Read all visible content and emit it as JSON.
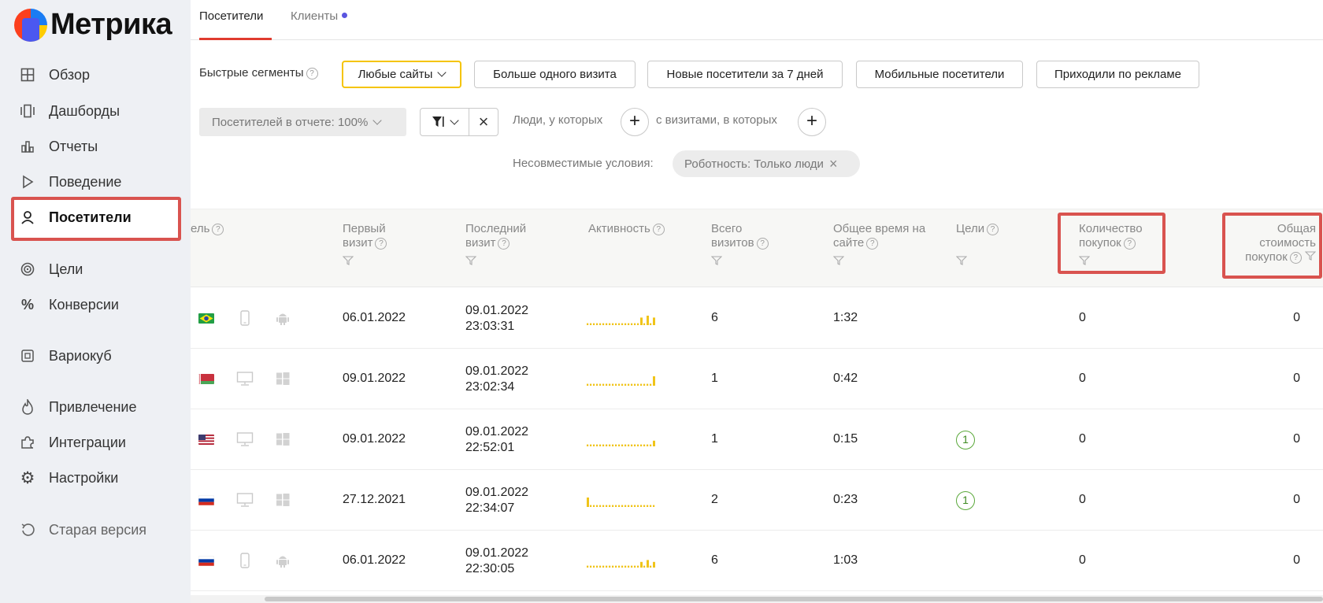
{
  "app": {
    "logo_text": "Метрика"
  },
  "sidebar": {
    "items": [
      {
        "label": "Обзор",
        "icon": "grid-icon"
      },
      {
        "label": "Дашборды",
        "icon": "dashboards-icon"
      },
      {
        "label": "Отчеты",
        "icon": "bar-chart-icon"
      },
      {
        "label": "Поведение",
        "icon": "play-icon"
      },
      {
        "label": "Посетители",
        "icon": "user-icon",
        "active": true
      },
      {
        "label": "Цели",
        "icon": "target-icon"
      },
      {
        "label": "Конверсии",
        "icon": "percent-icon"
      },
      {
        "label": "Вариокуб",
        "icon": "variocube-icon"
      },
      {
        "label": "Привлечение",
        "icon": "flame-icon"
      },
      {
        "label": "Интеграции",
        "icon": "puzzle-icon"
      },
      {
        "label": "Настройки",
        "icon": "gear-icon"
      },
      {
        "label": "Старая версия",
        "icon": "undo-icon"
      }
    ]
  },
  "tabs": [
    {
      "label": "Посетители",
      "active": true
    },
    {
      "label": "Клиенты",
      "active": false
    }
  ],
  "segments": {
    "label": "Быстрые сегменты",
    "selected": "Любые сайты",
    "buttons": [
      "Больше одного визита",
      "Новые посетители за 7 дней",
      "Мобильные посетители",
      "Приходили по рекламе"
    ]
  },
  "filters": {
    "report_share": "Посетителей в отчете: 100%",
    "people_label": "Люди, у которых",
    "visits_label": "с визитами, в которых",
    "incompatible_label": "Несовместимые условия:",
    "incompatible_chip": "Роботность: Только люди"
  },
  "table": {
    "columns": {
      "partial": "ель",
      "first_visit": [
        "Первый",
        "визит"
      ],
      "last_visit": [
        "Последний",
        "визит"
      ],
      "activity": "Активность",
      "total_visits": [
        "Всего",
        "визитов"
      ],
      "total_time": [
        "Общее время на",
        "сайте"
      ],
      "goals": "Цели",
      "purchases": [
        "Количество",
        "покупок"
      ],
      "purchase_value": [
        "Общая",
        "стоимость",
        "покупок"
      ]
    },
    "rows": [
      {
        "flag": "brazil",
        "device": "phone-icon",
        "os": "android-icon",
        "first_visit": "06.01.2022",
        "last_date": "09.01.2022",
        "last_time": "23:03:31",
        "visits": "6",
        "time": "1:32",
        "goals": "",
        "purchases": "0",
        "value": "0",
        "activity": [
          1,
          1,
          1,
          1,
          1,
          1,
          1,
          1,
          1,
          1,
          1,
          1,
          1,
          1,
          1,
          1,
          1,
          4,
          1,
          5,
          1,
          4
        ]
      },
      {
        "flag": "belarus",
        "device": "monitor-icon",
        "os": "windows-icon",
        "first_visit": "09.01.2022",
        "last_date": "09.01.2022",
        "last_time": "23:02:34",
        "visits": "1",
        "time": "0:42",
        "goals": "",
        "purchases": "0",
        "value": "0",
        "activity": [
          1,
          1,
          1,
          1,
          1,
          1,
          1,
          1,
          1,
          1,
          1,
          1,
          1,
          1,
          1,
          1,
          1,
          1,
          1,
          1,
          1,
          5
        ]
      },
      {
        "flag": "usa",
        "device": "monitor-icon",
        "os": "windows-icon",
        "first_visit": "09.01.2022",
        "last_date": "09.01.2022",
        "last_time": "22:52:01",
        "visits": "1",
        "time": "0:15",
        "goals": "1",
        "purchases": "0",
        "value": "0",
        "activity": [
          1,
          1,
          1,
          1,
          1,
          1,
          1,
          1,
          1,
          1,
          1,
          1,
          1,
          1,
          1,
          1,
          1,
          1,
          1,
          1,
          1,
          3
        ]
      },
      {
        "flag": "russia",
        "device": "monitor-icon",
        "os": "windows-icon",
        "first_visit": "27.12.2021",
        "last_date": "09.01.2022",
        "last_time": "22:34:07",
        "visits": "2",
        "time": "0:23",
        "goals": "1",
        "purchases": "0",
        "value": "0",
        "activity": [
          5,
          1,
          1,
          1,
          1,
          1,
          1,
          1,
          1,
          1,
          1,
          1,
          1,
          1,
          1,
          1,
          1,
          1,
          1,
          1,
          1,
          1
        ]
      },
      {
        "flag": "russia",
        "device": "phone-icon",
        "os": "android-icon",
        "first_visit": "06.01.2022",
        "last_date": "09.01.2022",
        "last_time": "22:30:05",
        "visits": "6",
        "time": "1:03",
        "goals": "",
        "purchases": "0",
        "value": "0",
        "activity": [
          1,
          1,
          1,
          1,
          1,
          1,
          1,
          1,
          1,
          1,
          1,
          1,
          1,
          1,
          1,
          1,
          1,
          3,
          1,
          4,
          1,
          3
        ]
      }
    ]
  },
  "colors": {
    "accent_red": "#d9534f",
    "tab_red": "#e03b2f",
    "segment_yellow": "#f5c400",
    "goal_green": "#5aa83a",
    "spark_yellow": "#f0c419"
  }
}
